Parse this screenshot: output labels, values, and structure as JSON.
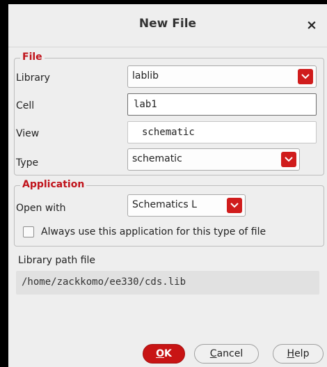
{
  "dialog": {
    "title": "New File",
    "close_glyph": "×"
  },
  "file_group": {
    "legend": "File",
    "library": {
      "label": "Library",
      "value": "lablib"
    },
    "cell": {
      "label": "Cell",
      "value": "lab1"
    },
    "view": {
      "label": "View",
      "value": "schematic"
    },
    "type": {
      "label": "Type",
      "value": "schematic"
    }
  },
  "application_group": {
    "legend": "Application",
    "open_with": {
      "label": "Open with",
      "value": "Schematics L"
    },
    "always_use": {
      "label": "Always use this application for this type of file",
      "checked": false
    }
  },
  "library_path": {
    "label": "Library path file",
    "value": "/home/zackkomo/ee330/cds.lib"
  },
  "buttons": {
    "ok": {
      "mnemonic": "O",
      "rest": "K"
    },
    "cancel": {
      "mnemonic": "C",
      "rest": "ancel"
    },
    "help": {
      "mnemonic": "H",
      "rest": "elp"
    }
  },
  "colors": {
    "accent": "#c0131b",
    "dialog_bg": "#eeeeee"
  },
  "icons": {
    "close": "close-icon",
    "dropdown": "chevron-down-icon"
  }
}
